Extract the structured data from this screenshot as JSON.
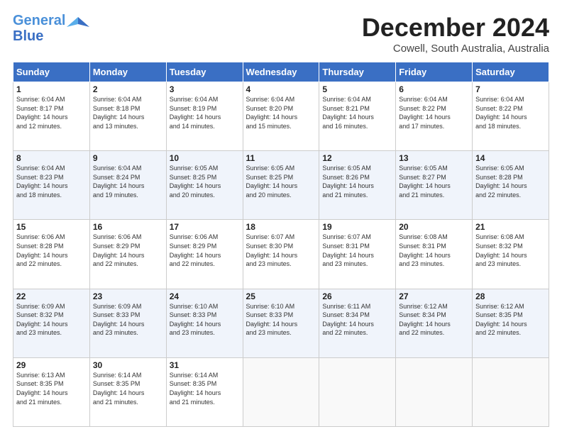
{
  "logo": {
    "line1": "General",
    "line2": "Blue"
  },
  "title": "December 2024",
  "subtitle": "Cowell, South Australia, Australia",
  "headers": [
    "Sunday",
    "Monday",
    "Tuesday",
    "Wednesday",
    "Thursday",
    "Friday",
    "Saturday"
  ],
  "weeks": [
    [
      {
        "day": "1",
        "info": "Sunrise: 6:04 AM\nSunset: 8:17 PM\nDaylight: 14 hours\nand 12 minutes."
      },
      {
        "day": "2",
        "info": "Sunrise: 6:04 AM\nSunset: 8:18 PM\nDaylight: 14 hours\nand 13 minutes."
      },
      {
        "day": "3",
        "info": "Sunrise: 6:04 AM\nSunset: 8:19 PM\nDaylight: 14 hours\nand 14 minutes."
      },
      {
        "day": "4",
        "info": "Sunrise: 6:04 AM\nSunset: 8:20 PM\nDaylight: 14 hours\nand 15 minutes."
      },
      {
        "day": "5",
        "info": "Sunrise: 6:04 AM\nSunset: 8:21 PM\nDaylight: 14 hours\nand 16 minutes."
      },
      {
        "day": "6",
        "info": "Sunrise: 6:04 AM\nSunset: 8:22 PM\nDaylight: 14 hours\nand 17 minutes."
      },
      {
        "day": "7",
        "info": "Sunrise: 6:04 AM\nSunset: 8:22 PM\nDaylight: 14 hours\nand 18 minutes."
      }
    ],
    [
      {
        "day": "8",
        "info": "Sunrise: 6:04 AM\nSunset: 8:23 PM\nDaylight: 14 hours\nand 18 minutes."
      },
      {
        "day": "9",
        "info": "Sunrise: 6:04 AM\nSunset: 8:24 PM\nDaylight: 14 hours\nand 19 minutes."
      },
      {
        "day": "10",
        "info": "Sunrise: 6:05 AM\nSunset: 8:25 PM\nDaylight: 14 hours\nand 20 minutes."
      },
      {
        "day": "11",
        "info": "Sunrise: 6:05 AM\nSunset: 8:25 PM\nDaylight: 14 hours\nand 20 minutes."
      },
      {
        "day": "12",
        "info": "Sunrise: 6:05 AM\nSunset: 8:26 PM\nDaylight: 14 hours\nand 21 minutes."
      },
      {
        "day": "13",
        "info": "Sunrise: 6:05 AM\nSunset: 8:27 PM\nDaylight: 14 hours\nand 21 minutes."
      },
      {
        "day": "14",
        "info": "Sunrise: 6:05 AM\nSunset: 8:28 PM\nDaylight: 14 hours\nand 22 minutes."
      }
    ],
    [
      {
        "day": "15",
        "info": "Sunrise: 6:06 AM\nSunset: 8:28 PM\nDaylight: 14 hours\nand 22 minutes."
      },
      {
        "day": "16",
        "info": "Sunrise: 6:06 AM\nSunset: 8:29 PM\nDaylight: 14 hours\nand 22 minutes."
      },
      {
        "day": "17",
        "info": "Sunrise: 6:06 AM\nSunset: 8:29 PM\nDaylight: 14 hours\nand 22 minutes."
      },
      {
        "day": "18",
        "info": "Sunrise: 6:07 AM\nSunset: 8:30 PM\nDaylight: 14 hours\nand 23 minutes."
      },
      {
        "day": "19",
        "info": "Sunrise: 6:07 AM\nSunset: 8:31 PM\nDaylight: 14 hours\nand 23 minutes."
      },
      {
        "day": "20",
        "info": "Sunrise: 6:08 AM\nSunset: 8:31 PM\nDaylight: 14 hours\nand 23 minutes."
      },
      {
        "day": "21",
        "info": "Sunrise: 6:08 AM\nSunset: 8:32 PM\nDaylight: 14 hours\nand 23 minutes."
      }
    ],
    [
      {
        "day": "22",
        "info": "Sunrise: 6:09 AM\nSunset: 8:32 PM\nDaylight: 14 hours\nand 23 minutes."
      },
      {
        "day": "23",
        "info": "Sunrise: 6:09 AM\nSunset: 8:33 PM\nDaylight: 14 hours\nand 23 minutes."
      },
      {
        "day": "24",
        "info": "Sunrise: 6:10 AM\nSunset: 8:33 PM\nDaylight: 14 hours\nand 23 minutes."
      },
      {
        "day": "25",
        "info": "Sunrise: 6:10 AM\nSunset: 8:33 PM\nDaylight: 14 hours\nand 23 minutes."
      },
      {
        "day": "26",
        "info": "Sunrise: 6:11 AM\nSunset: 8:34 PM\nDaylight: 14 hours\nand 22 minutes."
      },
      {
        "day": "27",
        "info": "Sunrise: 6:12 AM\nSunset: 8:34 PM\nDaylight: 14 hours\nand 22 minutes."
      },
      {
        "day": "28",
        "info": "Sunrise: 6:12 AM\nSunset: 8:35 PM\nDaylight: 14 hours\nand 22 minutes."
      }
    ],
    [
      {
        "day": "29",
        "info": "Sunrise: 6:13 AM\nSunset: 8:35 PM\nDaylight: 14 hours\nand 21 minutes."
      },
      {
        "day": "30",
        "info": "Sunrise: 6:14 AM\nSunset: 8:35 PM\nDaylight: 14 hours\nand 21 minutes."
      },
      {
        "day": "31",
        "info": "Sunrise: 6:14 AM\nSunset: 8:35 PM\nDaylight: 14 hours\nand 21 minutes."
      },
      {
        "day": "",
        "info": ""
      },
      {
        "day": "",
        "info": ""
      },
      {
        "day": "",
        "info": ""
      },
      {
        "day": "",
        "info": ""
      }
    ]
  ]
}
